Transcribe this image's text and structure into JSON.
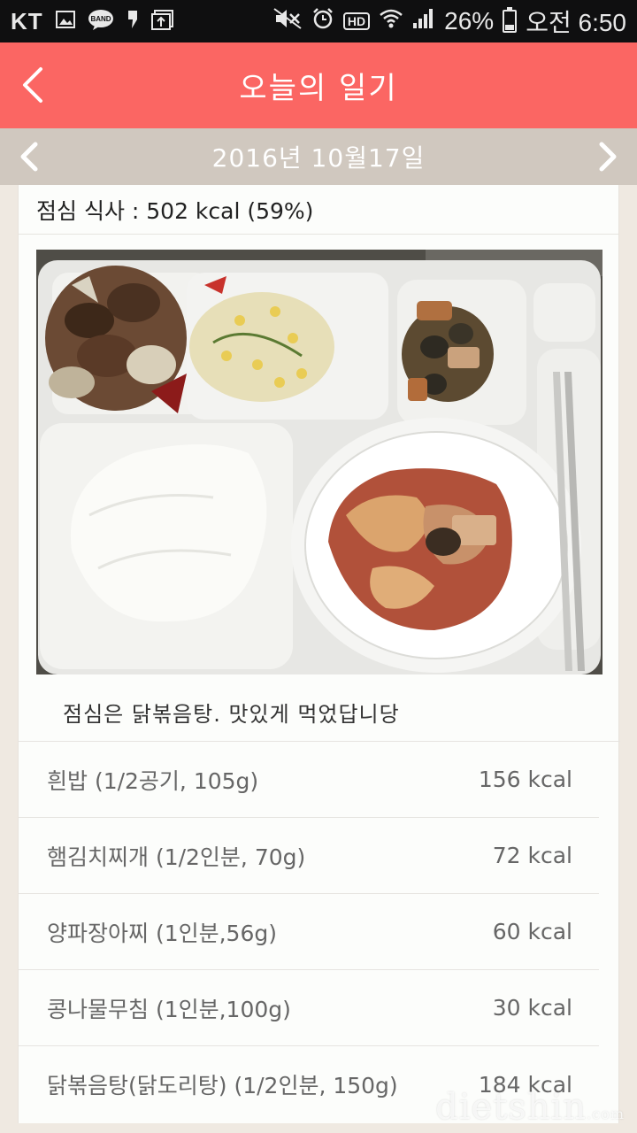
{
  "status": {
    "carrier": "KT",
    "icons_left": [
      "gallery-icon",
      "band-icon",
      "notification-icon",
      "download-icon"
    ],
    "hd": "HD",
    "battery_pct": "26%",
    "time": "오전 6:50",
    "battery_level": 0.26
  },
  "header": {
    "title": "오늘의 일기"
  },
  "date_bar": {
    "date": "2016년 10월17일"
  },
  "meal": {
    "summary": "점심 식사 : 502 kcal (59%)",
    "memo": "점심은 닭볶음탕. 맛있게 먹었답니당"
  },
  "foods": [
    {
      "name": "흰밥 (1/2공기, 105g)",
      "kcal": "156 kcal"
    },
    {
      "name": "햄김치찌개 (1/2인분, 70g)",
      "kcal": "72 kcal"
    },
    {
      "name": "양파장아찌 (1인분,56g)",
      "kcal": "60 kcal"
    },
    {
      "name": "콩나물무침 (1인분,100g)",
      "kcal": "30 kcal"
    },
    {
      "name": "닭볶음탕(닭도리탕) (1/2인분, 150g)",
      "kcal": "184 kcal"
    }
  ],
  "watermark": {
    "main": "dietshin",
    "suffix": ".com"
  },
  "colors": {
    "header_bg": "#fb6663",
    "date_bar_bg": "#d0c8bf",
    "page_bg": "#efe9e1"
  }
}
